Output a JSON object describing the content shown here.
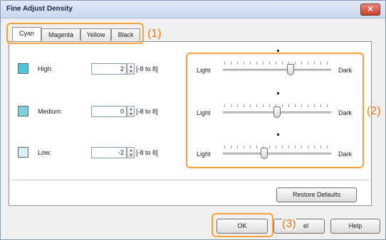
{
  "window": {
    "title": "Fine Adjust Density",
    "close_label": "✕"
  },
  "tabs": [
    {
      "label": "Cyan"
    },
    {
      "label": "Magenta"
    },
    {
      "label": "Yellow"
    },
    {
      "label": "Black"
    }
  ],
  "rows": [
    {
      "label": "High:",
      "value": "2",
      "range": "[-8 to 8]",
      "swatch_color": "#54c4d6",
      "level": 2
    },
    {
      "label": "Medium:",
      "value": "0",
      "range": "[-8 to 8]",
      "swatch_color": "#7fd0dc",
      "level": 0
    },
    {
      "label": "Low:",
      "value": "-2",
      "range": "[-8 to 8]",
      "swatch_color": "#d9f0f4",
      "level": -2
    }
  ],
  "slider": {
    "light_label": "Light",
    "dark_label": "Dark",
    "min": -8,
    "max": 8
  },
  "buttons": {
    "restore_defaults": "Restore Defaults",
    "ok": "OK",
    "cancel_partial": "el",
    "help": "Help"
  },
  "callouts": {
    "one": "(1)",
    "two": "(2)",
    "three": "(3)"
  },
  "colors": {
    "accent": "#f5a23c",
    "callout_text": "#e3791b"
  }
}
